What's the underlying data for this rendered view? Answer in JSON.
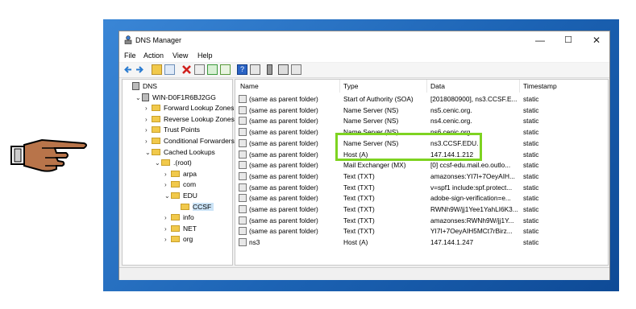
{
  "window": {
    "title": "DNS Manager",
    "minimize": "—",
    "maximize": "☐",
    "close": "✕"
  },
  "menu": [
    "File",
    "Action",
    "View",
    "Help"
  ],
  "toolbar_icons": [
    "back-icon",
    "forward-icon",
    "up-folder-icon",
    "show-hide-tree-icon",
    "delete-icon",
    "properties-icon",
    "refresh-icon",
    "export-icon",
    "help-icon",
    "console-icon",
    "server-icon",
    "list-icon",
    "record-icon"
  ],
  "tree": [
    {
      "label": "DNS",
      "depth": 0,
      "expander": "",
      "icon": "dns-icon"
    },
    {
      "label": "WIN-D0F1R6BJ2GG",
      "depth": 1,
      "expander": "⌄",
      "icon": "server-icon"
    },
    {
      "label": "Forward Lookup Zones",
      "depth": 2,
      "expander": "›",
      "icon": "folder-icon"
    },
    {
      "label": "Reverse Lookup Zones",
      "depth": 2,
      "expander": "›",
      "icon": "folder-icon"
    },
    {
      "label": "Trust Points",
      "depth": 2,
      "expander": "›",
      "icon": "folder-icon"
    },
    {
      "label": "Conditional Forwarders",
      "depth": 2,
      "expander": "›",
      "icon": "folder-icon"
    },
    {
      "label": "Cached Lookups",
      "depth": 2,
      "expander": "⌄",
      "icon": "folder-icon"
    },
    {
      "label": ".(root)",
      "depth": 3,
      "expander": "⌄",
      "icon": "folder-icon"
    },
    {
      "label": "arpa",
      "depth": 4,
      "expander": "›",
      "icon": "folder-icon"
    },
    {
      "label": "com",
      "depth": 4,
      "expander": "›",
      "icon": "folder-icon"
    },
    {
      "label": "EDU",
      "depth": 4,
      "expander": "⌄",
      "icon": "folder-icon"
    },
    {
      "label": "CCSF",
      "depth": 5,
      "expander": "",
      "icon": "folder-icon",
      "selected": true
    },
    {
      "label": "info",
      "depth": 4,
      "expander": "›",
      "icon": "folder-icon"
    },
    {
      "label": "NET",
      "depth": 4,
      "expander": "›",
      "icon": "folder-icon"
    },
    {
      "label": "org",
      "depth": 4,
      "expander": "›",
      "icon": "folder-icon"
    }
  ],
  "columns": [
    "Name",
    "Type",
    "Data",
    "Timestamp"
  ],
  "rows": [
    {
      "name": "(same as parent folder)",
      "type": "Start of Authority (SOA)",
      "data": "[2018080900], ns3.CCSF.E...",
      "ts": "static"
    },
    {
      "name": "(same as parent folder)",
      "type": "Name Server (NS)",
      "data": "ns5.cenic.org.",
      "ts": "static"
    },
    {
      "name": "(same as parent folder)",
      "type": "Name Server (NS)",
      "data": "ns4.cenic.org.",
      "ts": "static"
    },
    {
      "name": "(same as parent folder)",
      "type": "Name Server (NS)",
      "data": "ns6.cenic.org.",
      "ts": "static"
    },
    {
      "name": "(same as parent folder)",
      "type": "Name Server (NS)",
      "data": "ns3.CCSF.EDU.",
      "ts": "static"
    },
    {
      "name": "(same as parent folder)",
      "type": "Host (A)",
      "data": "147.144.1.212",
      "ts": "static"
    },
    {
      "name": "(same as parent folder)",
      "type": "Mail Exchanger (MX)",
      "data": "[0]  ccsf-edu.mail.eo.outlo...",
      "ts": "static"
    },
    {
      "name": "(same as parent folder)",
      "type": "Text (TXT)",
      "data": "amazonses:YI7I+7OeyAIH...",
      "ts": "static"
    },
    {
      "name": "(same as parent folder)",
      "type": "Text (TXT)",
      "data": "v=spf1 include:spf.protect...",
      "ts": "static"
    },
    {
      "name": "(same as parent folder)",
      "type": "Text (TXT)",
      "data": "adobe-sign-verification=e...",
      "ts": "static"
    },
    {
      "name": "(same as parent folder)",
      "type": "Text (TXT)",
      "data": "RWNh9W/jj1Yee1YahLI6K3...",
      "ts": "static"
    },
    {
      "name": "(same as parent folder)",
      "type": "Text (TXT)",
      "data": "amazonses:RWNh9W/jj1Y...",
      "ts": "static"
    },
    {
      "name": "(same as parent folder)",
      "type": "Text (TXT)",
      "data": "YI7I+7OeyAIH5MCt7rBirz...",
      "ts": "static"
    },
    {
      "name": "ns3",
      "type": "Host (A)",
      "data": "147.144.1.247",
      "ts": "static"
    }
  ],
  "colors": {
    "highlight": "#7ed321",
    "selection": "#cce4f7",
    "desktop": "#1c63b4"
  }
}
